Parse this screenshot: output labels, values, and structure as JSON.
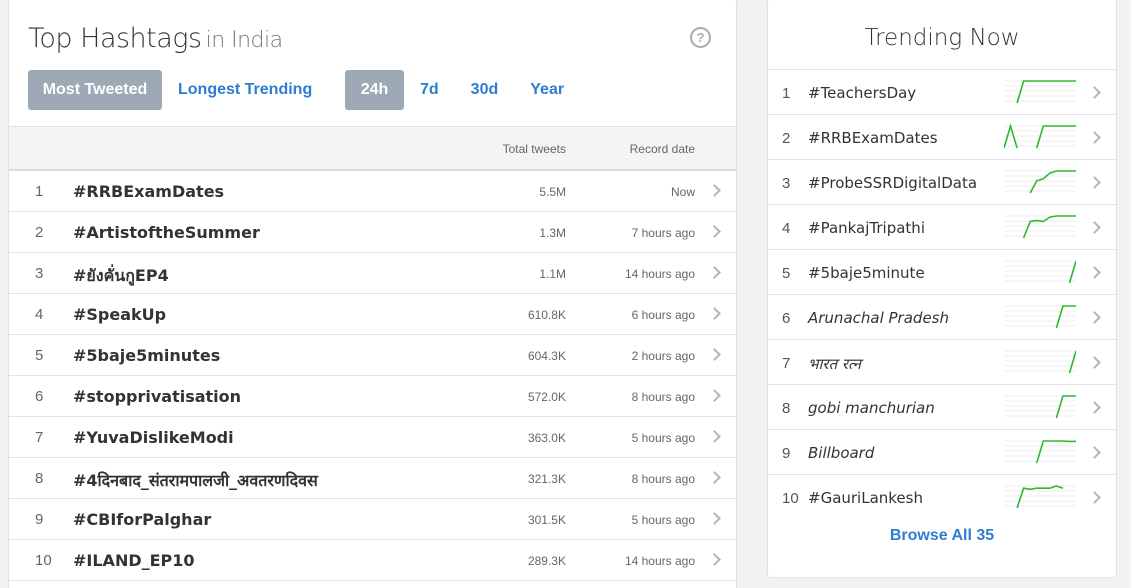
{
  "top_hashtags": {
    "title": "Top Hashtags",
    "subtitle": "in India",
    "help_icon": "?",
    "tabs_type": [
      {
        "label": "Most Tweeted",
        "active": true
      },
      {
        "label": "Longest Trending",
        "active": false
      }
    ],
    "tabs_period": [
      {
        "label": "24h",
        "active": true
      },
      {
        "label": "7d",
        "active": false
      },
      {
        "label": "30d",
        "active": false
      },
      {
        "label": "Year",
        "active": false
      }
    ],
    "columns": {
      "total": "Total tweets",
      "record": "Record date"
    },
    "rows": [
      {
        "rank": "1",
        "tag": "#RRBExamDates",
        "total": "5.5M",
        "date": "Now"
      },
      {
        "rank": "2",
        "tag": "#ArtistoftheSummer",
        "total": "1.3M",
        "date": "7 hours ago"
      },
      {
        "rank": "3",
        "tag": "#ยังคั่นกูEP4",
        "total": "1.1M",
        "date": "14 hours ago"
      },
      {
        "rank": "4",
        "tag": "#SpeakUp",
        "total": "610.8K",
        "date": "6 hours ago"
      },
      {
        "rank": "5",
        "tag": "#5baje5minutes",
        "total": "604.3K",
        "date": "2 hours ago"
      },
      {
        "rank": "6",
        "tag": "#stopprivatisation",
        "total": "572.0K",
        "date": "8 hours ago"
      },
      {
        "rank": "7",
        "tag": "#YuvaDislikeModi",
        "total": "363.0K",
        "date": "5 hours ago"
      },
      {
        "rank": "8",
        "tag": "#4दिनबाद_संतरामपालजी_अवतरणदिवस",
        "total": "321.3K",
        "date": "8 hours ago"
      },
      {
        "rank": "9",
        "tag": "#CBIforPalghar",
        "total": "301.5K",
        "date": "5 hours ago"
      },
      {
        "rank": "10",
        "tag": "#ILAND_EP10",
        "total": "289.3K",
        "date": "14 hours ago"
      }
    ]
  },
  "trending_now": {
    "title": "Trending Now",
    "line_color": "#2eb82e",
    "items": [
      {
        "rank": "1",
        "name": "#TeachersDay",
        "italic": false,
        "spark": [
          null,
          null,
          0.0,
          1,
          1,
          1,
          1,
          1,
          1,
          1,
          1,
          1
        ]
      },
      {
        "rank": "2",
        "name": "#RRBExamDates",
        "italic": false,
        "spark": [
          0.0,
          1,
          0.0,
          null,
          null,
          0.0,
          1,
          1,
          1,
          1,
          1,
          1
        ]
      },
      {
        "rank": "3",
        "name": "#ProbeSSRDigitalData",
        "italic": false,
        "spark": [
          null,
          null,
          null,
          null,
          0.0,
          0.55,
          0.65,
          0.9,
          1,
          1,
          1,
          1
        ]
      },
      {
        "rank": "4",
        "name": "#PankajTripathi",
        "italic": false,
        "spark": [
          null,
          null,
          null,
          0.0,
          0.75,
          0.8,
          0.75,
          0.95,
          1,
          1,
          1,
          1
        ]
      },
      {
        "rank": "5",
        "name": "#5baje5minute",
        "italic": false,
        "spark": [
          null,
          null,
          null,
          null,
          null,
          null,
          null,
          null,
          null,
          null,
          0.0,
          1
        ]
      },
      {
        "rank": "6",
        "name": "Arunachal Pradesh",
        "italic": true,
        "spark": [
          null,
          null,
          null,
          null,
          null,
          null,
          null,
          null,
          0.0,
          1,
          1,
          1
        ]
      },
      {
        "rank": "7",
        "name": "भारत रत्न",
        "italic": true,
        "spark": [
          null,
          null,
          null,
          null,
          null,
          null,
          null,
          null,
          null,
          null,
          0.0,
          1
        ]
      },
      {
        "rank": "8",
        "name": "gobi manchurian",
        "italic": true,
        "spark": [
          null,
          null,
          null,
          null,
          null,
          null,
          null,
          null,
          0.0,
          1,
          1,
          1
        ]
      },
      {
        "rank": "9",
        "name": "Billboard",
        "italic": true,
        "spark": [
          null,
          null,
          null,
          null,
          null,
          0.0,
          1,
          1,
          1,
          1,
          0.98,
          0.98
        ]
      },
      {
        "rank": "10",
        "name": "#GauriLankesh",
        "italic": false,
        "spark": [
          null,
          null,
          0.0,
          0.9,
          0.85,
          0.9,
          0.9,
          0.9,
          1,
          0.9,
          null,
          null
        ]
      }
    ],
    "browse_label": "Browse All 35"
  }
}
